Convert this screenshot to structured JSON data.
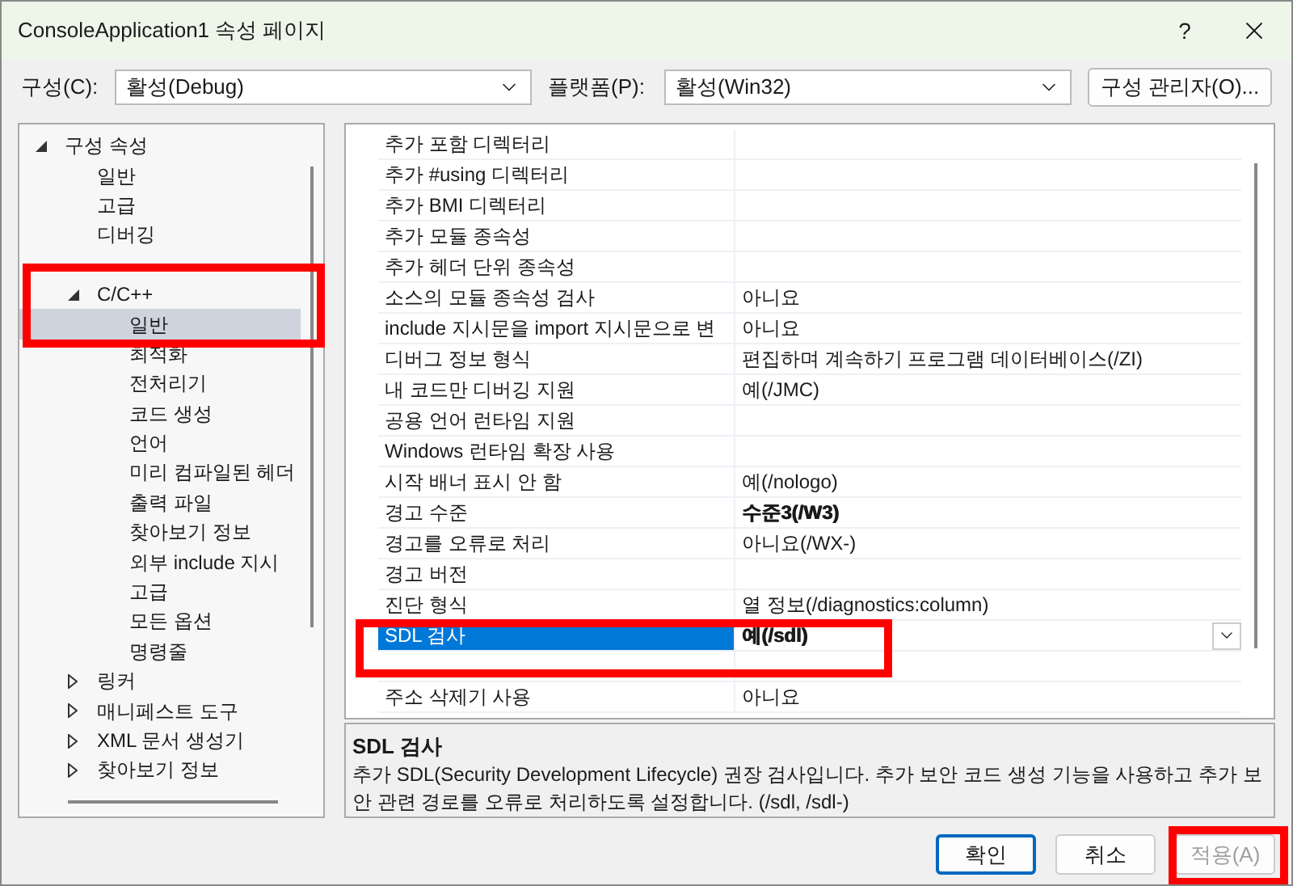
{
  "window": {
    "title": "ConsoleApplication1 속성 페이지",
    "help": "?"
  },
  "config": {
    "configuration_label": "구성(C):",
    "configuration_value": "활성(Debug)",
    "platform_label": "플랫폼(P):",
    "platform_value": "활성(Win32)",
    "manager_button": "구성 관리자(O)..."
  },
  "tree": [
    {
      "label": "구성 속성",
      "expanded": true,
      "selected": false,
      "children": [
        {
          "label": "일반",
          "selected": false
        },
        {
          "label": "고급",
          "selected": false
        },
        {
          "label": "디버깅",
          "selected": false
        },
        {
          "selected": false
        },
        {
          "label": "C/C++",
          "expanded": true,
          "selected": false,
          "children": [
            {
              "label": "일반",
              "selected": true
            },
            {
              "label": "최적화",
              "selected": false
            },
            {
              "label": "전처리기",
              "selected": false
            },
            {
              "label": "코드 생성",
              "selected": false
            },
            {
              "label": "언어",
              "selected": false
            },
            {
              "label": "미리 컴파일된 헤더",
              "selected": false
            },
            {
              "label": "출력 파일",
              "selected": false
            },
            {
              "label": "찾아보기 정보",
              "selected": false
            },
            {
              "label": "외부 include 지시",
              "selected": false
            },
            {
              "label": "고급",
              "selected": false
            },
            {
              "label": "모든 옵션",
              "selected": false
            },
            {
              "label": "명령줄",
              "selected": false
            }
          ]
        },
        {
          "label": "링커",
          "expanded": false,
          "selected": false
        },
        {
          "label": "매니페스트 도구",
          "expanded": false,
          "selected": false
        },
        {
          "label": "XML 문서 생성기",
          "expanded": false,
          "selected": false
        },
        {
          "label": "찾아보기 정보",
          "expanded": false,
          "selected": false
        }
      ]
    }
  ],
  "properties": [
    {
      "name": "추가 포함 디렉터리",
      "selected": false
    },
    {
      "name": "추가 #using 디렉터리",
      "selected": false
    },
    {
      "name": "추가 BMI 디렉터리",
      "selected": false
    },
    {
      "name": "추가 모듈 종속성",
      "selected": false
    },
    {
      "name": "추가 헤더 단위 종속성",
      "selected": false
    },
    {
      "name": "소스의 모듈 종속성 검사",
      "value": "아니요",
      "bold": false,
      "selected": false
    },
    {
      "name": "include 지시문을 import 지시문으로 변",
      "value": "아니요",
      "bold": false,
      "selected": false
    },
    {
      "name": "디버그 정보 형식",
      "value": "편집하며 계속하기 프로그램 데이터베이스(/ZI)",
      "bold": false,
      "selected": false
    },
    {
      "name": "내 코드만 디버깅 지원",
      "value": "예(/JMC)",
      "bold": false,
      "selected": false
    },
    {
      "name": "공용 언어 런타임 지원",
      "selected": false
    },
    {
      "name": "Windows 런타임 확장 사용",
      "selected": false
    },
    {
      "name": "시작 배너 표시 안 함",
      "value": "예(/nologo)",
      "bold": false,
      "selected": false
    },
    {
      "name": "경고 수준",
      "value": "수준3(/W3)",
      "bold": true,
      "selected": false
    },
    {
      "name": "경고를 오류로 처리",
      "value": "아니요(/WX-)",
      "bold": false,
      "selected": false
    },
    {
      "name": "경고 버전",
      "selected": false
    },
    {
      "name": "진단 형식",
      "value": "열 정보(/diagnostics:column)",
      "bold": false,
      "selected": false
    },
    {
      "name": "SDL 검사",
      "value": "예(/sdl)",
      "bold": true,
      "selected": true
    },
    {
      "selected": false
    },
    {
      "name": "주소 삭제기 사용",
      "value": "아니요",
      "bold": false,
      "selected": false
    }
  ],
  "description": {
    "title": "SDL 검사",
    "text": "추가 SDL(Security Development Lifecycle) 권장 검사입니다. 추가 보안 코드 생성 기능을 사용하고 추가 보안 관련 경로를 오류로 처리하도록 설정합니다. (/sdl, /sdl-)"
  },
  "buttons": [
    {
      "label": "확인",
      "primary": true,
      "disabled": false
    },
    {
      "label": "취소",
      "primary": false,
      "disabled": false
    },
    {
      "label": "적용(A)",
      "primary": false,
      "disabled": true
    }
  ]
}
